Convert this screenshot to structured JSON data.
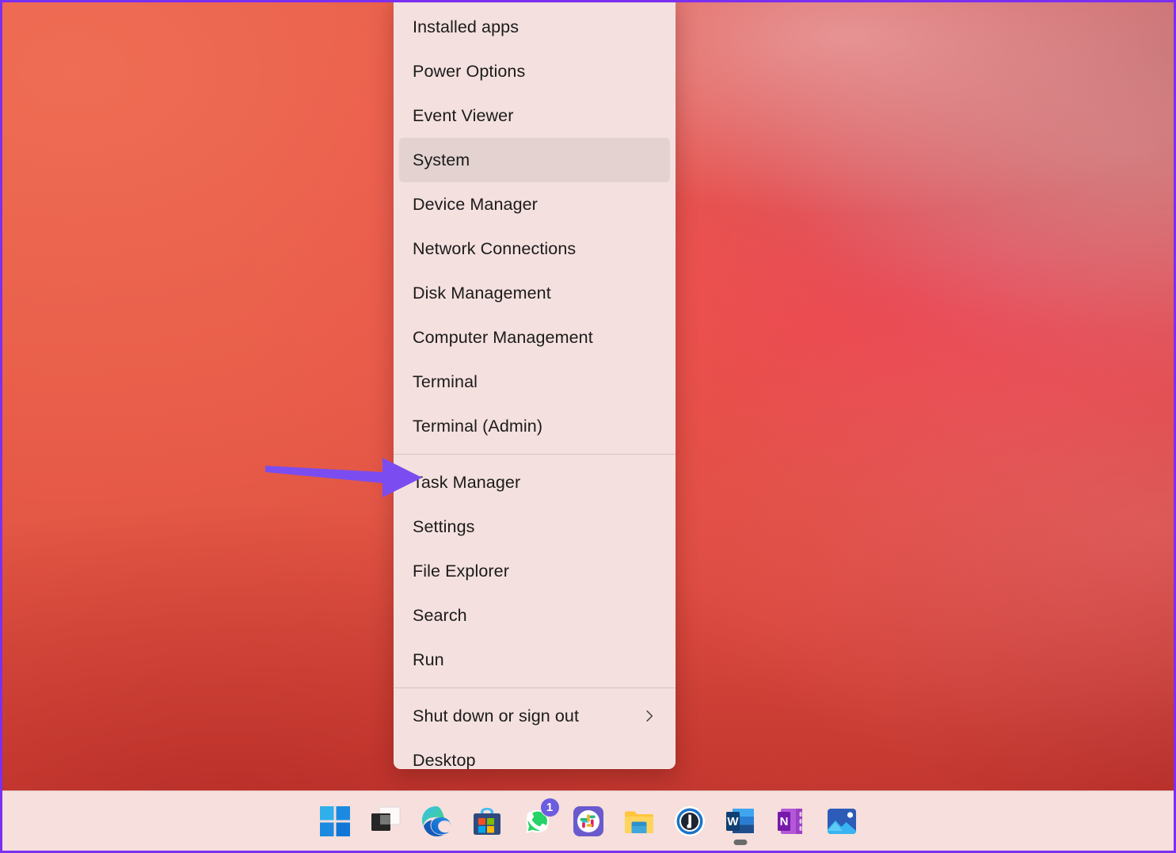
{
  "window": {
    "border_color": "#7B2FF0",
    "wallpaper_description": "coral red gradient"
  },
  "context_menu": {
    "name": "Windows quick link (Win+X) menu",
    "background_color": "#F4E0DE",
    "selected_item": "System",
    "sections": [
      {
        "items": [
          {
            "label": "Installed apps",
            "selected": false,
            "submenu": false
          },
          {
            "label": "Power Options",
            "selected": false,
            "submenu": false
          },
          {
            "label": "Event Viewer",
            "selected": false,
            "submenu": false
          },
          {
            "label": "System",
            "selected": true,
            "submenu": false
          },
          {
            "label": "Device Manager",
            "selected": false,
            "submenu": false
          },
          {
            "label": "Network Connections",
            "selected": false,
            "submenu": false
          },
          {
            "label": "Disk Management",
            "selected": false,
            "submenu": false
          },
          {
            "label": "Computer Management",
            "selected": false,
            "submenu": false
          },
          {
            "label": "Terminal",
            "selected": false,
            "submenu": false
          },
          {
            "label": "Terminal (Admin)",
            "selected": false,
            "submenu": false
          }
        ]
      },
      {
        "items": [
          {
            "label": "Task Manager",
            "selected": false,
            "submenu": false
          },
          {
            "label": "Settings",
            "selected": false,
            "submenu": false
          },
          {
            "label": "File Explorer",
            "selected": false,
            "submenu": false
          },
          {
            "label": "Search",
            "selected": false,
            "submenu": false
          },
          {
            "label": "Run",
            "selected": false,
            "submenu": false
          }
        ]
      },
      {
        "items": [
          {
            "label": "Shut down or sign out",
            "selected": false,
            "submenu": true
          },
          {
            "label": "Desktop",
            "selected": false,
            "submenu": false
          }
        ]
      }
    ]
  },
  "annotation": {
    "arrow_color": "#7B4DF0",
    "points_to": "Task Manager"
  },
  "taskbar": {
    "background_color": "#F6DFDC",
    "items": [
      {
        "name": "start",
        "label": "Start",
        "badge": null,
        "running": false
      },
      {
        "name": "task-view",
        "label": "Task View",
        "badge": null,
        "running": false
      },
      {
        "name": "edge",
        "label": "Microsoft Edge",
        "badge": null,
        "running": false
      },
      {
        "name": "microsoft-store",
        "label": "Microsoft Store",
        "badge": null,
        "running": false
      },
      {
        "name": "whatsapp",
        "label": "WhatsApp",
        "badge": "1",
        "running": false
      },
      {
        "name": "slack",
        "label": "Slack",
        "badge": null,
        "running": false
      },
      {
        "name": "file-explorer",
        "label": "File Explorer",
        "badge": null,
        "running": false
      },
      {
        "name": "1password",
        "label": "1Password",
        "badge": null,
        "running": false
      },
      {
        "name": "word",
        "label": "Microsoft Word",
        "badge": null,
        "running": true
      },
      {
        "name": "onenote",
        "label": "Microsoft OneNote",
        "badge": null,
        "running": false
      },
      {
        "name": "photos",
        "label": "Photos",
        "badge": null,
        "running": false
      }
    ]
  }
}
